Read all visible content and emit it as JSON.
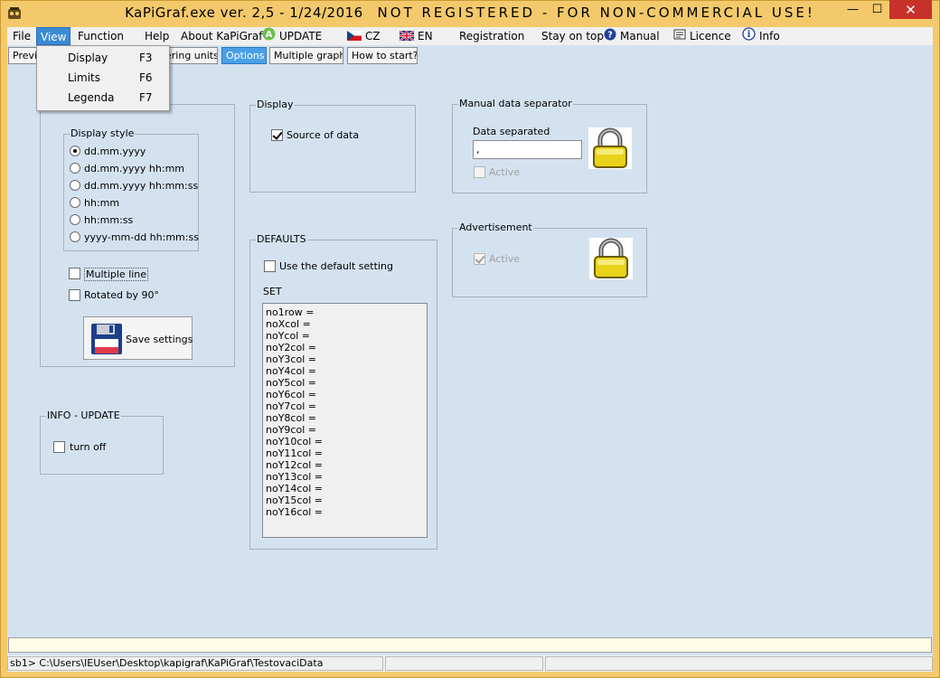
{
  "window": {
    "title_main": "KaPiGraf.exe   ver. 2,5  - 1/24/2016",
    "title_reg": "NOT REGISTERED - FOR NON-COMMERCIAL USE!",
    "minimize": "—",
    "maximize": "☐",
    "close": "✕"
  },
  "menubar": {
    "file": "File",
    "view": "View",
    "function": "Function",
    "help": "Help",
    "about": "About KaPiGraf",
    "update": "UPDATE",
    "cz": "CZ",
    "en": "EN",
    "registration": "Registration",
    "stay_on_top": "Stay on top",
    "manual": "Manual",
    "licence": "Licence",
    "info": "Info"
  },
  "toolbar": {
    "preview": "Previ",
    "filtering_units": "ering units",
    "options": "Options",
    "multiple_graphs": "Multiple graphs",
    "how_to_start": "How to start?"
  },
  "view_menu": {
    "items": [
      {
        "label": "Display",
        "key": "F3"
      },
      {
        "label": "Limits",
        "key": "F6"
      },
      {
        "label": "Legenda",
        "key": "F7"
      }
    ]
  },
  "display_group": {
    "style_title": "Display style",
    "options": [
      "dd.mm.yyyy",
      "dd.mm.yyyy hh:mm",
      "dd.mm.yyyy hh:mm:ss",
      "hh:mm",
      "hh:mm:ss",
      "yyyy-mm-dd hh:mm:ss"
    ],
    "selected_index": 0,
    "multiple_line": "Multiple line",
    "rotated": "Rotated by 90°",
    "save_settings": "Save settings"
  },
  "info_update": {
    "title": "INFO - UPDATE",
    "turn_off": "turn off"
  },
  "display_source": {
    "title": "Display",
    "source_of_data": "Source of data",
    "checked": true
  },
  "defaults": {
    "title": "DEFAULTS",
    "use_default": "Use the default setting",
    "set_label": "SET",
    "lines": [
      "no1row =",
      "noXcol =",
      "noYcol =",
      "noY2col =",
      "noY3col =",
      "noY4col =",
      "noY5col =",
      "noY6col =",
      "noY7col =",
      "noY8col =",
      "noY9col =",
      "noY10col =",
      "noY11col =",
      "noY12col =",
      "noY13col =",
      "noY14col =",
      "noY15col =",
      "noY16col ="
    ]
  },
  "manual_separator": {
    "title": "Manual data separator",
    "label": "Data separated",
    "value": ",",
    "active": "Active"
  },
  "advertisement": {
    "title": "Advertisement",
    "active": "Active"
  },
  "statusbar": {
    "path": "sb1> C:\\Users\\IEUser\\Desktop\\kapigraf\\KaPiGraf\\TestovaciData"
  },
  "colors": {
    "frame": "#f3c96b",
    "client": "#d4e2f0",
    "accent": "#3b8ad6",
    "close": "#c7312b"
  }
}
